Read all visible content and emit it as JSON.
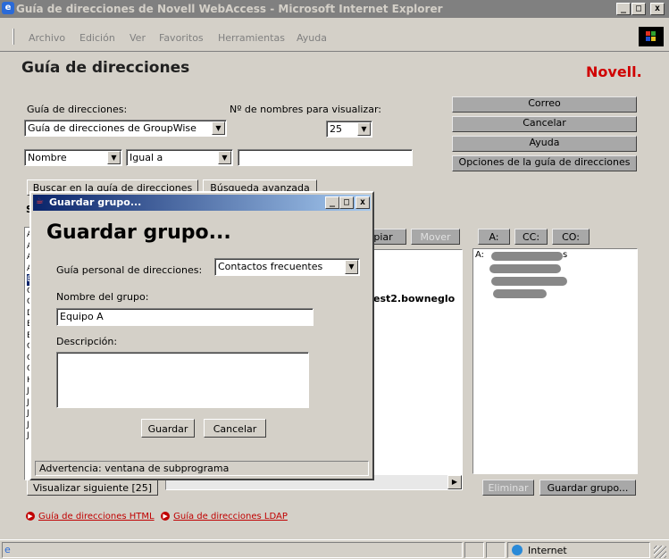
{
  "window": {
    "title": "Guía de direcciones de Novell WebAccess - Microsoft Internet Explorer",
    "min": "_",
    "max": "□",
    "close": "x"
  },
  "menu": [
    "Archivo",
    "Edición",
    "Ver",
    "Favoritos",
    "Herramientas",
    "Ayuda"
  ],
  "page": {
    "heading": "Guía de direcciones",
    "brand": "Novell.",
    "book_label": "Guía de direcciones:",
    "book_value": "Guía de direcciones de GroupWise",
    "count_label": "Nº de nombres para visualizar:",
    "count_value": "25",
    "field_value": "Nombre",
    "op_value": "Igual a",
    "search_value": "",
    "search_btn": "Buscar en la guía de direcciones",
    "adv_btn": "Búsqueda avanzada",
    "side_buttons": [
      "Correo",
      "Cancelar",
      "Ayuda",
      "Opciones de la guía de direcciones"
    ],
    "copy_btn": "piar",
    "move_btn": "Mover",
    "to_btn": "A:",
    "cc_btn": "CC:",
    "bc_btn": "CO:",
    "name_col": "est2.bowneglo",
    "recipient_prefix": "A:",
    "recipient_suffix": "s",
    "next_btn": "Visualizar siguiente [25]",
    "remove_btn": "Eliminar",
    "save_group_btn": "Guardar grupo...",
    "link_html": "Guía de direcciones HTML",
    "link_ldap": "Guía de direcciones LDAP",
    "left_letter": "S",
    "left_list_letters": [
      "A",
      "A",
      "A",
      "A",
      "B",
      "C",
      "C",
      "D",
      "E",
      "E",
      "G",
      "C",
      "C",
      "H",
      "J",
      "J",
      "J",
      "J",
      "J"
    ]
  },
  "dialog": {
    "title": "Guardar grupo...",
    "heading": "Guardar grupo...",
    "book_label": "Guía personal de direcciones:",
    "book_value": "Contactos frecuentes",
    "name_label": "Nombre del grupo:",
    "name_value": "Equipo A",
    "desc_label": "Descripción:",
    "desc_value": "",
    "save": "Guardar",
    "cancel": "Cancelar",
    "warning": "Advertencia: ventana de subprograma"
  },
  "status": {
    "zone": "Internet"
  }
}
